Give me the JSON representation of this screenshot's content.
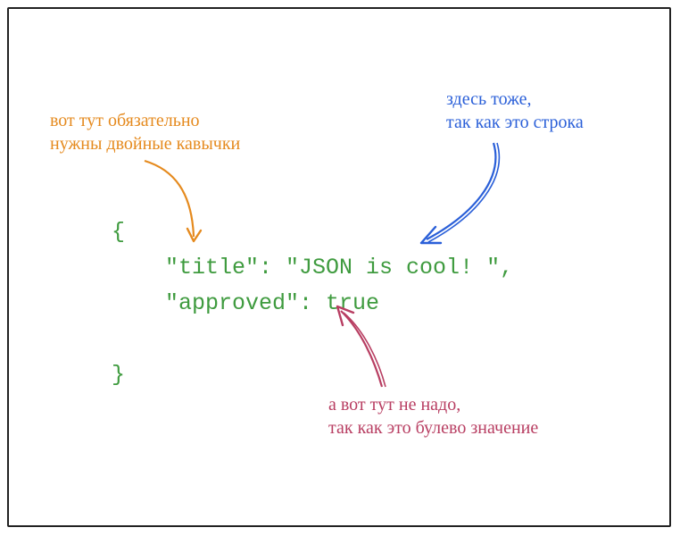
{
  "annotations": {
    "orange": {
      "line1": "вот тут обязательно",
      "line2": "нужны двойные кавычки"
    },
    "blue": {
      "line1": "здесь тоже,",
      "line2": "так как это строка"
    },
    "pink": {
      "line1": "а вот тут не надо,",
      "line2": "так как это булево значение"
    }
  },
  "code": {
    "line1": "{",
    "line2": "    \"title\": \"JSON is cool! \",",
    "line3": "    \"approved\": true",
    "line4": "",
    "line5": "}"
  },
  "colors": {
    "code": "#3f9b3f",
    "orange": "#e58a1e",
    "blue": "#2a5fd8",
    "pink": "#b83e62",
    "frame": "#222222"
  }
}
